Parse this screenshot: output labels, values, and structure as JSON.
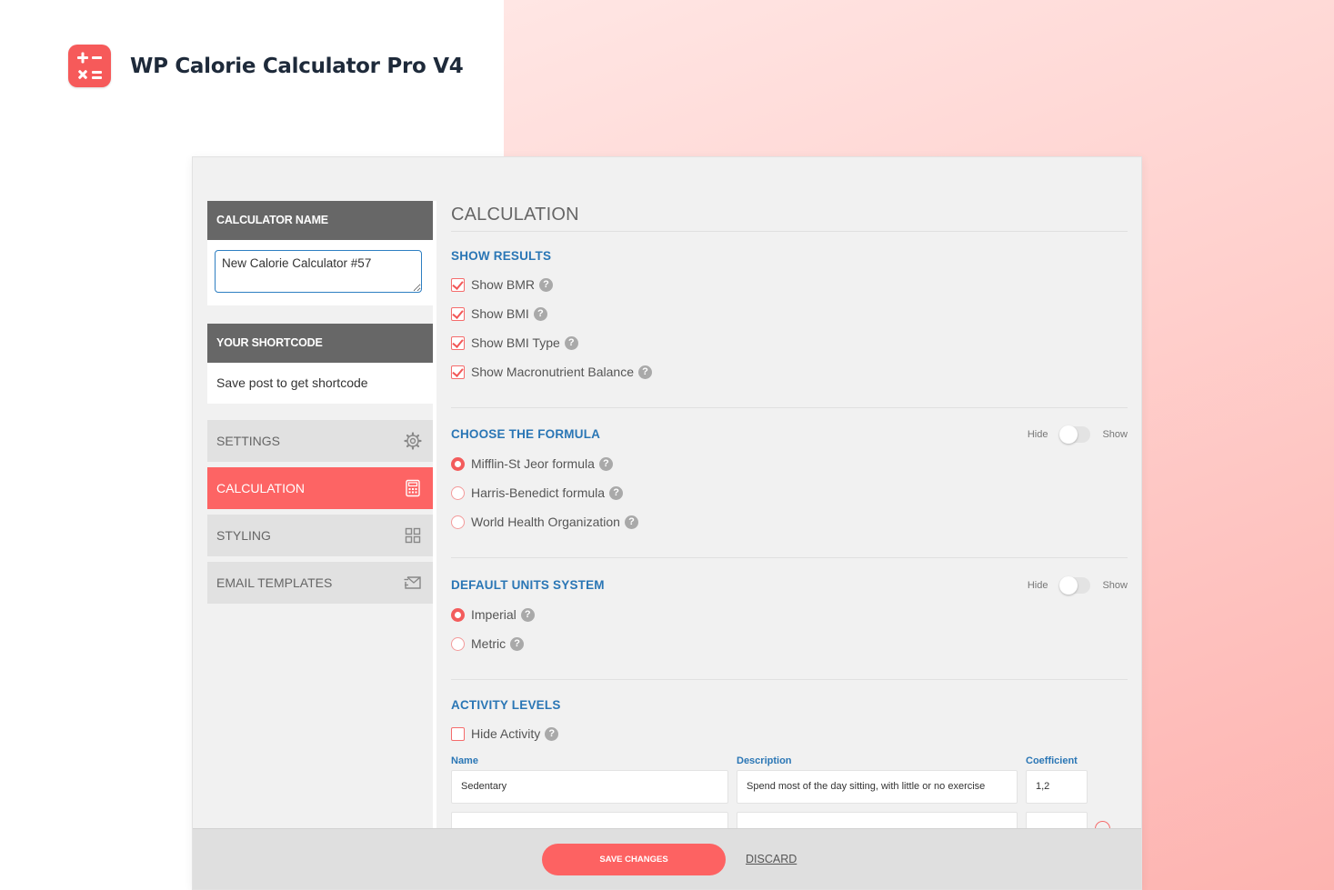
{
  "brand": {
    "title": "WP Calorie Calculator Pro V4",
    "logo_icon": "calculator-icon"
  },
  "sidebar": {
    "calculator_name_header": "CALCULATOR NAME",
    "calculator_name_value": "New Calorie Calculator #57",
    "shortcode_header": "YOUR SHORTCODE",
    "shortcode_text": "Save post to get shortcode",
    "nav": [
      {
        "label": "SETTINGS",
        "icon": "gear-icon",
        "active": false
      },
      {
        "label": "CALCULATION",
        "icon": "calculator-icon",
        "active": true
      },
      {
        "label": "STYLING",
        "icon": "grid-icon",
        "active": false
      },
      {
        "label": "EMAIL TEMPLATES",
        "icon": "envelope-icon",
        "active": false
      }
    ]
  },
  "main": {
    "section_title": "CALCULATION",
    "show_results": {
      "title": "SHOW RESULTS",
      "items": [
        {
          "label": "Show BMR",
          "checked": true
        },
        {
          "label": "Show BMI",
          "checked": true
        },
        {
          "label": "Show BMI Type",
          "checked": true
        },
        {
          "label": "Show Macronutrient Balance",
          "checked": true
        }
      ]
    },
    "formula": {
      "title": "CHOOSE THE FORMULA",
      "toggle_hide": "Hide",
      "toggle_show": "Show",
      "options": [
        {
          "label": "Mifflin-St Jeor formula",
          "selected": true
        },
        {
          "label": "Harris-Benedict formula",
          "selected": false
        },
        {
          "label": "World Health Organization",
          "selected": false
        }
      ]
    },
    "units": {
      "title": "DEFAULT UNITS SYSTEM",
      "toggle_hide": "Hide",
      "toggle_show": "Show",
      "options": [
        {
          "label": "Imperial",
          "selected": true
        },
        {
          "label": "Metric",
          "selected": false
        }
      ]
    },
    "activity": {
      "title": "ACTIVITY LEVELS",
      "hide_label": "Hide Activity",
      "hide_checked": false,
      "columns": {
        "name": "Name",
        "description": "Description",
        "coefficient": "Coefficient"
      },
      "rows": [
        {
          "name": "Sedentary",
          "description": "Spend most of the day sitting, with little or no exercise",
          "coefficient": "1,2"
        }
      ]
    }
  },
  "footer": {
    "save_label": "SAVE CHANGES",
    "discard_label": "DISCARD"
  },
  "colors": {
    "accent": "#fd6464",
    "link_blue": "#2a76b5",
    "sidebar_header": "#676767"
  }
}
